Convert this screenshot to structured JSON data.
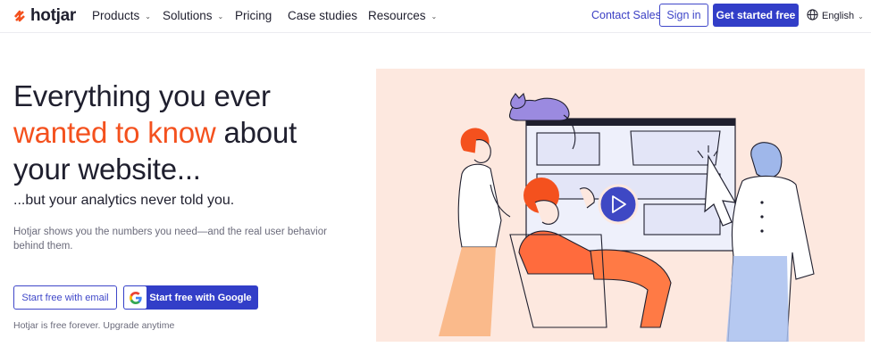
{
  "nav": {
    "brand": "hotjar",
    "items": [
      {
        "label": "Products",
        "has_menu": true
      },
      {
        "label": "Solutions",
        "has_menu": true
      },
      {
        "label": "Pricing",
        "has_menu": false
      },
      {
        "label": "Case studies",
        "has_menu": false
      },
      {
        "label": "Resources",
        "has_menu": true
      }
    ],
    "contact_label": "Contact Sales",
    "signin_label": "Sign in",
    "get_started_label": "Get started free",
    "language_label": "English"
  },
  "hero": {
    "headline_line1": "Everything you ever",
    "headline_highlight": "wanted to know",
    "headline_after_highlight": " about",
    "headline_line3": "your website...",
    "subhead": "...but your analytics never told you.",
    "description": "Hotjar shows you the numbers you need—and the real user behavior behind them.",
    "email_button_label": "Start free with email",
    "google_button_label": "Start free with Google",
    "free_note": "Hotjar is free forever. Upgrade anytime"
  },
  "icons": {
    "logo": "hotjar-flame-icon",
    "chevron": "chevron-down-icon",
    "globe": "globe-icon",
    "google": "google-g-icon",
    "play": "play-icon"
  },
  "colors": {
    "brand_blue": "#323ec8",
    "accent_orange": "#f4511e",
    "illustration_bg": "#fde8df",
    "text_dark": "#1f1f2e",
    "text_muted": "#6b6b7b"
  }
}
